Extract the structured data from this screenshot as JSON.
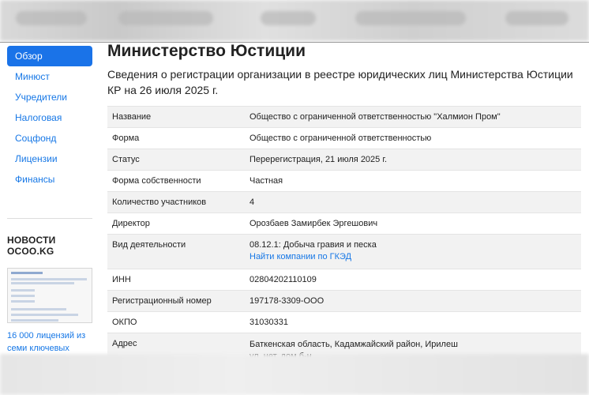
{
  "sidebar": {
    "items": [
      {
        "label": "Обзор",
        "active": true
      },
      {
        "label": "Минюст"
      },
      {
        "label": "Учредители"
      },
      {
        "label": "Налоговая"
      },
      {
        "label": "Соцфонд"
      },
      {
        "label": "Лицензии"
      },
      {
        "label": "Финансы"
      }
    ],
    "news_title": "НОВОСТИ OCOO.KG",
    "news_link_line1": "16 000 лицензий из",
    "news_link_line2": "семи ключевых"
  },
  "main": {
    "title": "Министерство Юстиции",
    "subtitle": "Сведения о регистрации организации в реестре юридических лиц Министерства Юстиции КР на 26 июля 2025 г.",
    "rows": [
      {
        "label": "Название",
        "value": "Общество с ограниченной ответственностью \"Халмион Пром\""
      },
      {
        "label": "Форма",
        "value": "Общество с ограниченной ответственностью"
      },
      {
        "label": "Статус",
        "value": "Перерегистрация, 21 июля 2025 г."
      },
      {
        "label": "Форма собственности",
        "value": "Частная"
      },
      {
        "label": "Количество участников",
        "value": "4"
      },
      {
        "label": "Директор",
        "value": "Орозбаев Замирбек Эргешович"
      },
      {
        "label": "Вид деятельности",
        "value": "08.12.1: Добыча гравия и песка",
        "link": "Найти компании по ГКЭД"
      },
      {
        "label": "ИНН",
        "value": "02804202110109"
      },
      {
        "label": "Регистрационный номер",
        "value": "197178-3309-ООО"
      },
      {
        "label": "ОКПО",
        "value": "31030331"
      },
      {
        "label": "Адрес",
        "value": "Баткенская область, Кадамжайский район, Ирилеш",
        "value2": "ул. нет, дом б-н"
      }
    ]
  },
  "colors": {
    "accent": "#1a73e8",
    "link": "#1677e6",
    "row_alt": "#f2f2f2"
  }
}
